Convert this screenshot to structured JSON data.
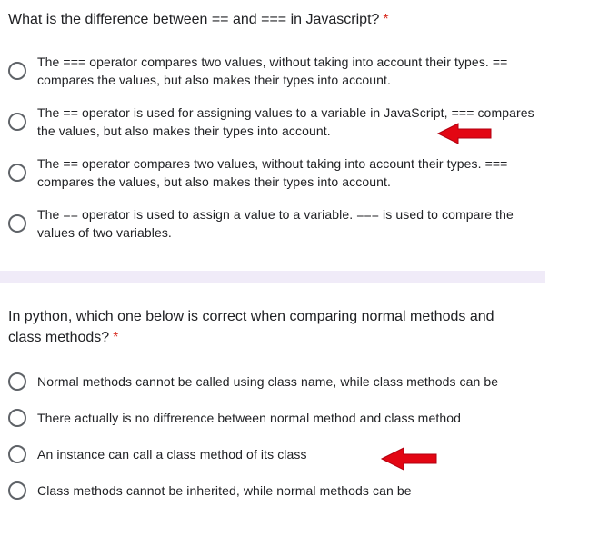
{
  "q1": {
    "title": "What is the difference between == and === in Javascript?",
    "required": "*",
    "options": [
      {
        "line1": "The === operator compares two values, without taking into account their types. ==",
        "line2": "compares the values, but also makes their types into account."
      },
      {
        "line1": "The == operator is used for assigning values to a variable in JavaScript, === compares",
        "line2": "the values, but also makes their types into account."
      },
      {
        "line1": "The == operator compares two values, without taking into account their types. ===",
        "line2": "compares the values, but also makes their types into account."
      },
      {
        "line1": "The == operator is used to assign a value to a variable. === is used to compare the",
        "line2": "values of two variables."
      }
    ]
  },
  "q2": {
    "title_line1": "In python, which one below is correct when comparing normal methods and",
    "title_line2": "class methods?",
    "required": "*",
    "options": [
      {
        "label": "Normal methods cannot be called using class name, while class methods can be"
      },
      {
        "label": "There actually is no diffrerence between normal method and class method"
      },
      {
        "label": "An instance can call a class method of its class"
      },
      {
        "label": "Class methods cannot be inherited, while normal methods can be"
      }
    ]
  },
  "colors": {
    "required": "#d93025",
    "divider": "#f0ebf8",
    "arrow": "#e30613",
    "radio_border": "#5f6368"
  },
  "icons": [
    "radio-unchecked-icon",
    "red-arrow-annotation-icon"
  ]
}
